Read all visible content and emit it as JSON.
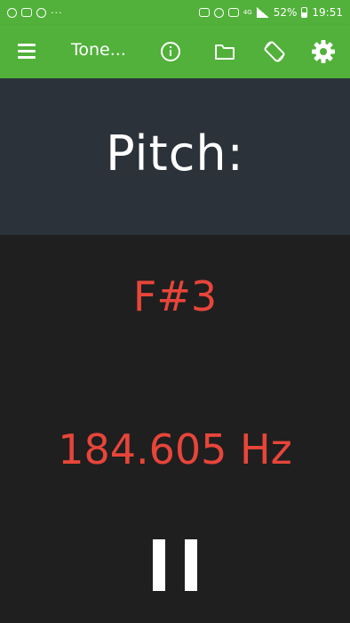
{
  "status_bar": {
    "network": "4G",
    "battery": "52%",
    "time": "19:51",
    "dots": "···"
  },
  "app_bar": {
    "title": "Tone..."
  },
  "pitch": {
    "label": "Pitch:"
  },
  "readout": {
    "note": "F#3",
    "frequency": "184.605 Hz"
  },
  "colors": {
    "accent": "#51b13a",
    "header_bg": "#2b323a",
    "body_bg": "#1f1f1f",
    "readout": "#e8453a"
  }
}
